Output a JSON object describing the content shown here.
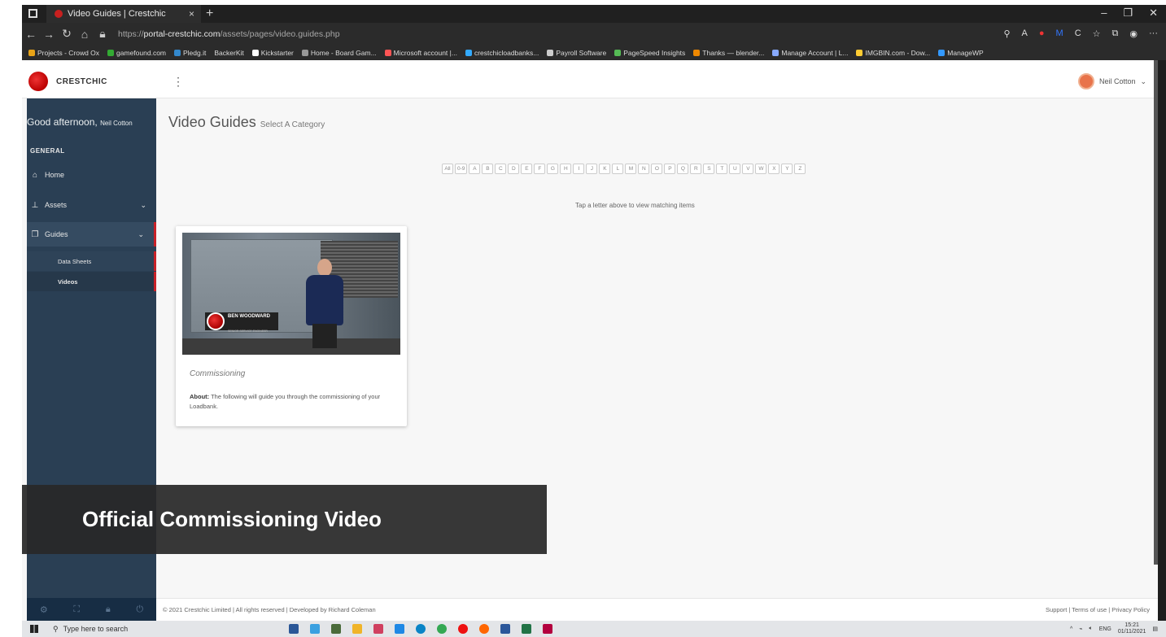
{
  "browser": {
    "tab_title": "Video Guides | Crestchic",
    "new_tab": "+",
    "close_tab": "×",
    "url_prefix": "https://",
    "url_host": "portal-crestchic.com",
    "url_path": "/assets/pages/video.guides.php",
    "bookmarks": [
      "Projects - Crowd Ox",
      "gamefound.com",
      "Pledg.it",
      "BackerKit",
      "Kickstarter",
      "Home - Board Gam...",
      "Microsoft account |...",
      "crestchicloadbanks...",
      "Payroll Software",
      "PageSpeed Insights",
      "Thanks — blender...",
      "Manage Account | L...",
      "IMGBIN.com - Dow...",
      "ManageWP"
    ]
  },
  "app": {
    "brand": "CRESTCHIC",
    "user_name": "Neil Cotton",
    "greeting": "Good afternoon,",
    "greeting_name": "Neil Cotton",
    "section_label": "GENERAL",
    "nav": {
      "home": "Home",
      "assets": "Assets",
      "guides": "Guides",
      "data_sheets": "Data Sheets",
      "videos": "Videos"
    },
    "title": "Video Guides",
    "subtitle": "Select A Category",
    "letters": [
      "All",
      "0-9",
      "A",
      "B",
      "C",
      "D",
      "E",
      "F",
      "G",
      "H",
      "I",
      "J",
      "K",
      "L",
      "M",
      "N",
      "O",
      "P",
      "Q",
      "R",
      "S",
      "T",
      "U",
      "V",
      "W",
      "X",
      "Y",
      "Z"
    ],
    "hint": "Tap a letter above to view matching items",
    "card": {
      "thumb_name": "BEN WOODWARD",
      "thumb_role": "SENIOR SERVICE ENGINEER",
      "title": "Commissioning",
      "about_label": "About:",
      "about_text": " The following will guide you through the commissioning of your Loadbank."
    },
    "footer_left": "© 2021 Crestchic Limited | All rights reserved | Developed by Richard Coleman",
    "footer_right": "Support |  Terms of use |  Privacy Policy"
  },
  "overlay_caption": "Official Commissioning Video",
  "taskbar": {
    "search_placeholder": "Type here to search",
    "lang": "ENG",
    "time": "15:21",
    "date": "01/11/2021"
  }
}
